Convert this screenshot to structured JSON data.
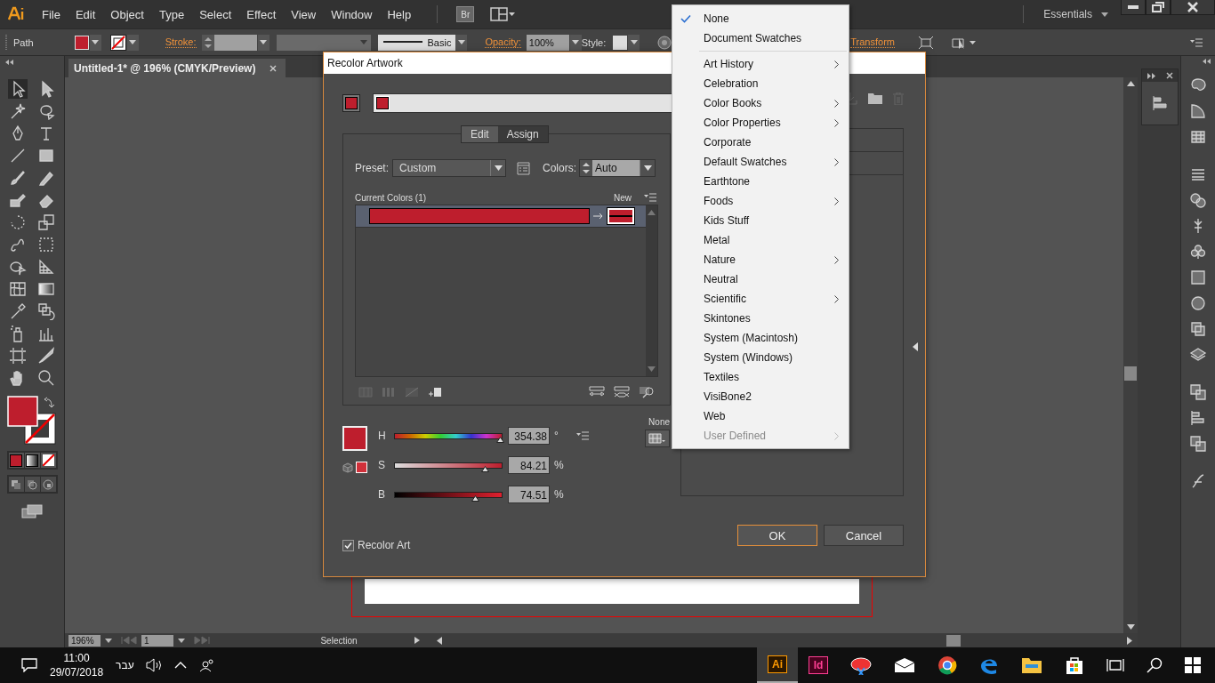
{
  "app_menu": [
    "File",
    "Edit",
    "Object",
    "Type",
    "Select",
    "Effect",
    "View",
    "Window",
    "Help"
  ],
  "bridge_button": "Br",
  "workspace": "Essentials",
  "control_bar": {
    "object_type": "Path",
    "stroke_label": "Stroke:",
    "brush": "Basic",
    "opacity_label": "Opacity:",
    "opacity": "100%",
    "style_label": "Style:",
    "transform": "Transform"
  },
  "document_tab": {
    "title": "Untitled-1* @ 196% (CMYK/Preview)",
    "selected": true
  },
  "status_bar": {
    "zoom": "196%",
    "artboard": "1",
    "tool": "Selection"
  },
  "dialog": {
    "title": "Recolor Artwork",
    "tabs": [
      {
        "label": "Edit",
        "selected": false
      },
      {
        "label": "Assign",
        "selected": true
      }
    ],
    "preset_label": "Preset:",
    "preset": "Custom",
    "colors_label": "Colors:",
    "colors": "Auto",
    "current_colors_label": "Current Colors (1)",
    "new_label": "New",
    "color_rows": [
      {
        "selected": true
      }
    ],
    "sliders": [
      {
        "label": "H",
        "level": 0.98,
        "value": "354.38",
        "unit": "°"
      },
      {
        "label": "S",
        "level": 0.84,
        "value": "84.21",
        "unit": "%"
      },
      {
        "label": "B",
        "level": 0.75,
        "value": "74.51",
        "unit": "%"
      }
    ],
    "none_label": "None",
    "recolor_art": {
      "label": "Recolor Art",
      "checked": true
    },
    "buttons": [
      {
        "label": "OK",
        "default": true
      },
      {
        "label": "Cancel",
        "default": false
      }
    ]
  },
  "color_group_menu": {
    "sections": [
      {
        "items": [
          {
            "label": "None",
            "checked": true,
            "submenu": false,
            "disabled": false
          },
          {
            "label": "Document Swatches",
            "checked": false,
            "submenu": false,
            "disabled": false
          }
        ]
      },
      {
        "items": [
          {
            "label": "Art History",
            "checked": false,
            "submenu": true,
            "disabled": false
          },
          {
            "label": "Celebration",
            "checked": false,
            "submenu": false,
            "disabled": false
          },
          {
            "label": "Color Books",
            "checked": false,
            "submenu": true,
            "disabled": false
          },
          {
            "label": "Color Properties",
            "checked": false,
            "submenu": true,
            "disabled": false
          },
          {
            "label": "Corporate",
            "checked": false,
            "submenu": false,
            "disabled": false
          },
          {
            "label": "Default Swatches",
            "checked": false,
            "submenu": true,
            "disabled": false
          },
          {
            "label": "Earthtone",
            "checked": false,
            "submenu": false,
            "disabled": false
          },
          {
            "label": "Foods",
            "checked": false,
            "submenu": true,
            "disabled": false
          },
          {
            "label": "Kids Stuff",
            "checked": false,
            "submenu": false,
            "disabled": false
          },
          {
            "label": "Metal",
            "checked": false,
            "submenu": false,
            "disabled": false
          },
          {
            "label": "Nature",
            "checked": false,
            "submenu": true,
            "disabled": false
          },
          {
            "label": "Neutral",
            "checked": false,
            "submenu": false,
            "disabled": false
          },
          {
            "label": "Scientific",
            "checked": false,
            "submenu": true,
            "disabled": false
          },
          {
            "label": "Skintones",
            "checked": false,
            "submenu": false,
            "disabled": false
          },
          {
            "label": "System (Macintosh)",
            "checked": false,
            "submenu": false,
            "disabled": false
          },
          {
            "label": "System (Windows)",
            "checked": false,
            "submenu": false,
            "disabled": false
          },
          {
            "label": "Textiles",
            "checked": false,
            "submenu": false,
            "disabled": false
          },
          {
            "label": "VisiBone2",
            "checked": false,
            "submenu": false,
            "disabled": false
          },
          {
            "label": "Web",
            "checked": false,
            "submenu": false,
            "disabled": false
          },
          {
            "label": "User Defined",
            "checked": false,
            "submenu": true,
            "disabled": true
          }
        ]
      }
    ]
  },
  "taskbar": {
    "time": "11:00",
    "date": "29/07/2018",
    "language": "עבר",
    "apps": [
      {
        "label": "Ai",
        "kind": "ai"
      },
      {
        "label": "Id",
        "kind": "id"
      }
    ]
  }
}
